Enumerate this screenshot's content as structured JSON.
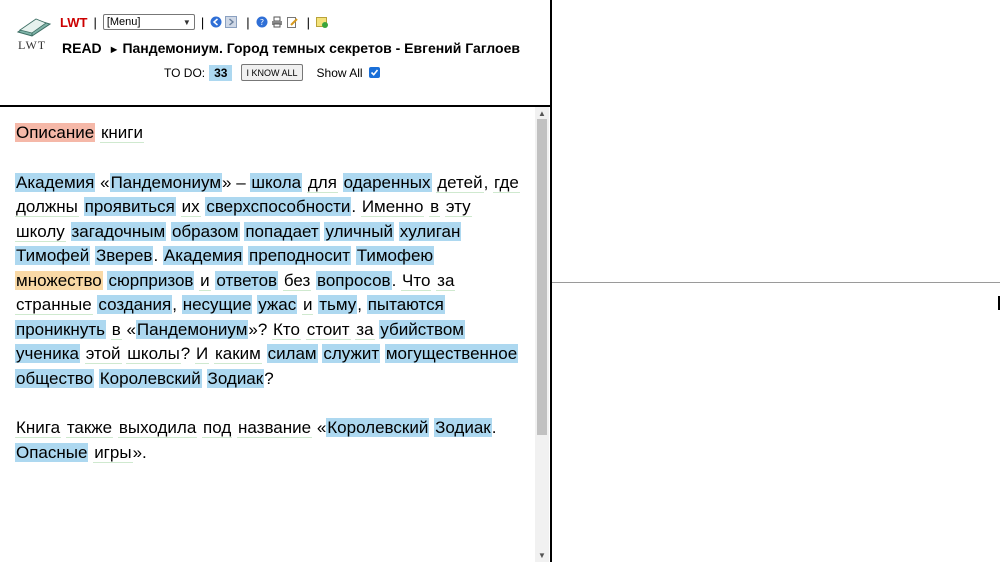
{
  "header": {
    "logo_text": "LWT",
    "app_link": "LWT",
    "menu_selected": "[Menu]",
    "read_label": "READ",
    "book_title": "Пандемониум. Город темных секретов - Евгений Гаглоев",
    "todo_label": "TO DO:",
    "todo_count": "33",
    "know_all_label": "I KNOW ALL",
    "show_all_label": "Show All",
    "toolbar_icons": [
      "nav-back-icon",
      "nav-next-icon",
      "help-icon",
      "print-icon",
      "edit-icon",
      "new-text-icon"
    ]
  },
  "text": {
    "paragraphs": [
      [
        {
          "t": "Описание",
          "s": "0"
        },
        {
          "t": " "
        },
        {
          "t": "книги",
          "s": "new"
        }
      ],
      [
        {
          "t": "Академия",
          "s": "1"
        },
        {
          "t": " «"
        },
        {
          "t": "Пандемониум",
          "s": "1"
        },
        {
          "t": "» – "
        },
        {
          "t": "школа",
          "s": "1"
        },
        {
          "t": " "
        },
        {
          "t": "для",
          "s": "new"
        },
        {
          "t": " "
        },
        {
          "t": "одаренных",
          "s": "1"
        },
        {
          "t": " "
        },
        {
          "t": "детей",
          "s": "new"
        },
        {
          "t": ", "
        },
        {
          "t": "где",
          "s": "new"
        },
        {
          "t": " "
        },
        {
          "t": "должны",
          "s": "new"
        },
        {
          "t": " "
        },
        {
          "t": "проявиться",
          "s": "1"
        },
        {
          "t": " "
        },
        {
          "t": "их",
          "s": "new"
        },
        {
          "t": " "
        },
        {
          "t": "сверхспособности",
          "s": "1"
        },
        {
          "t": ". "
        },
        {
          "t": "Именно",
          "s": "new"
        },
        {
          "t": " "
        },
        {
          "t": "в",
          "s": "new"
        },
        {
          "t": " "
        },
        {
          "t": "эту",
          "s": "new"
        },
        {
          "t": " "
        },
        {
          "t": "школу",
          "s": "new"
        },
        {
          "t": " "
        },
        {
          "t": "загадочным",
          "s": "1"
        },
        {
          "t": " "
        },
        {
          "t": "образом",
          "s": "1"
        },
        {
          "t": " "
        },
        {
          "t": "попадает",
          "s": "1"
        },
        {
          "t": " "
        },
        {
          "t": "уличный",
          "s": "1"
        },
        {
          "t": " "
        },
        {
          "t": "хулиган",
          "s": "1"
        },
        {
          "t": " "
        },
        {
          "t": "Тимофей",
          "s": "1"
        },
        {
          "t": " "
        },
        {
          "t": "Зверев",
          "s": "1"
        },
        {
          "t": ". "
        },
        {
          "t": "Академия",
          "s": "1"
        },
        {
          "t": " "
        },
        {
          "t": "преподносит",
          "s": "1"
        },
        {
          "t": " "
        },
        {
          "t": "Тимофею",
          "s": "1"
        },
        {
          "t": " "
        },
        {
          "t": "множество",
          "s": "2"
        },
        {
          "t": " "
        },
        {
          "t": "сюрпризов",
          "s": "1"
        },
        {
          "t": " "
        },
        {
          "t": "и",
          "s": "new"
        },
        {
          "t": " "
        },
        {
          "t": "ответов",
          "s": "1"
        },
        {
          "t": " "
        },
        {
          "t": "без",
          "s": "new"
        },
        {
          "t": " "
        },
        {
          "t": "вопросов",
          "s": "1"
        },
        {
          "t": ". "
        },
        {
          "t": "Что",
          "s": "new"
        },
        {
          "t": " "
        },
        {
          "t": "за",
          "s": "new"
        },
        {
          "t": " "
        },
        {
          "t": "странные",
          "s": "new"
        },
        {
          "t": " "
        },
        {
          "t": "создания",
          "s": "1"
        },
        {
          "t": ", "
        },
        {
          "t": "несущие",
          "s": "1"
        },
        {
          "t": " "
        },
        {
          "t": "ужас",
          "s": "1"
        },
        {
          "t": " "
        },
        {
          "t": "и",
          "s": "new"
        },
        {
          "t": " "
        },
        {
          "t": "тьму",
          "s": "1"
        },
        {
          "t": ", "
        },
        {
          "t": "пытаются",
          "s": "1"
        },
        {
          "t": " "
        },
        {
          "t": "проникнуть",
          "s": "1"
        },
        {
          "t": " "
        },
        {
          "t": "в",
          "s": "new"
        },
        {
          "t": " «"
        },
        {
          "t": "Пандемониум",
          "s": "1"
        },
        {
          "t": "»? "
        },
        {
          "t": "Кто",
          "s": "new"
        },
        {
          "t": " "
        },
        {
          "t": "стоит",
          "s": "new"
        },
        {
          "t": " "
        },
        {
          "t": "за",
          "s": "new"
        },
        {
          "t": " "
        },
        {
          "t": "убийством",
          "s": "1"
        },
        {
          "t": " "
        },
        {
          "t": "ученика",
          "s": "1"
        },
        {
          "t": " "
        },
        {
          "t": "этой",
          "s": "new"
        },
        {
          "t": " "
        },
        {
          "t": "школы",
          "s": "new"
        },
        {
          "t": "? "
        },
        {
          "t": "И",
          "s": "new"
        },
        {
          "t": " "
        },
        {
          "t": "каким",
          "s": "new"
        },
        {
          "t": " "
        },
        {
          "t": "силам",
          "s": "1"
        },
        {
          "t": " "
        },
        {
          "t": "служит",
          "s": "1"
        },
        {
          "t": " "
        },
        {
          "t": "могущественное",
          "s": "1"
        },
        {
          "t": " "
        },
        {
          "t": "общество",
          "s": "1"
        },
        {
          "t": " "
        },
        {
          "t": "Королевский",
          "s": "1"
        },
        {
          "t": " "
        },
        {
          "t": "Зодиак",
          "s": "1"
        },
        {
          "t": "?"
        }
      ],
      [
        {
          "t": "Книга",
          "s": "new"
        },
        {
          "t": " "
        },
        {
          "t": "также",
          "s": "new"
        },
        {
          "t": " "
        },
        {
          "t": "выходила",
          "s": "new"
        },
        {
          "t": " "
        },
        {
          "t": "под",
          "s": "new"
        },
        {
          "t": " "
        },
        {
          "t": "название",
          "s": "new"
        },
        {
          "t": " «"
        },
        {
          "t": "Королевский",
          "s": "1"
        },
        {
          "t": " "
        },
        {
          "t": "Зодиак",
          "s": "1"
        },
        {
          "t": ". "
        },
        {
          "t": "Опасные",
          "s": "1"
        },
        {
          "t": " "
        },
        {
          "t": "игры",
          "s": "new"
        },
        {
          "t": "»."
        }
      ]
    ]
  },
  "colors": {
    "status_known_learning": "#add8f0",
    "status_new_marked": "#f5b8a8",
    "status_level2": "#f9d9a6",
    "app_link": "#cc0000"
  }
}
